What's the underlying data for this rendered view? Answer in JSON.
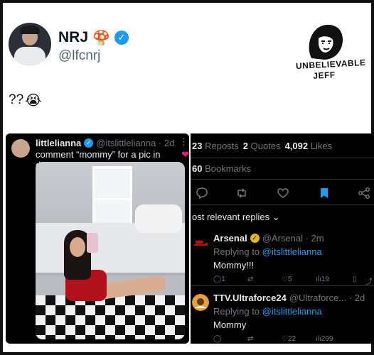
{
  "author": {
    "display_name": "NRJ",
    "name_emoji": "🍄",
    "handle": "@lfcnrj",
    "verified": true
  },
  "logo": {
    "line1": "UNBELIEVABLE",
    "line2": "JEFF"
  },
  "tweet": {
    "text": "??",
    "emoji": "😭"
  },
  "quoted": {
    "display_name": "littlelianna",
    "handle_time": "@itslittlelianna · 2d",
    "menu": "⋮",
    "text": "comment “mommy” for a pic in dms",
    "heart": "❤"
  },
  "stats": {
    "reposts_count": "23",
    "reposts_label": "Reposts",
    "quotes_count": "2",
    "quotes_label": "Quotes",
    "likes_count": "4,092",
    "likes_label": "Likes",
    "bookmarks_count": "60",
    "bookmarks_label": "Bookmarks"
  },
  "replies_sort": "ost relevant replies ⌄",
  "replies": [
    {
      "name": "Arsenal",
      "handle_time": "@Arsenal · 2m",
      "replying": "Replying to",
      "replying_to": "@itslittlelianna",
      "text": "Mommy!!!",
      "comments": "1",
      "likes": "5",
      "views": "19"
    },
    {
      "name": "TTV.Ultraforce24",
      "handle_time": "@Ultraforce... · 2d",
      "replying": "Replying to",
      "replying_to": "@itslittlelianna",
      "text": "Mommy",
      "likes": "22",
      "views": "299"
    }
  ],
  "colors": {
    "link": "#1d9bf0",
    "verified": "#1d9bf0",
    "heart": "#f91880",
    "arsenal_red": "#db0007"
  }
}
